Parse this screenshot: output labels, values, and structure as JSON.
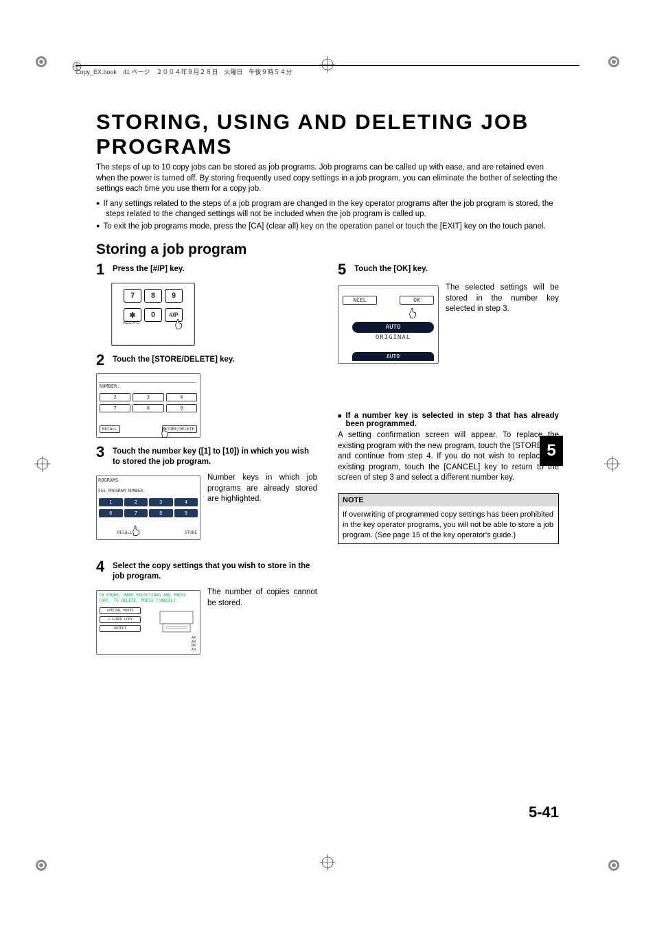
{
  "header": {
    "meta_line": "Copy_EX.book　41 ページ　２００４年９月２８日　火曜日　午後９時５４分"
  },
  "title": "STORING, USING AND DELETING JOB PROGRAMS",
  "intro": "The steps of up to 10 copy jobs can be stored as job programs. Job programs can be called up with ease, and are retained even when the power is turned off. By storing frequently used copy settings in  a job program, you can eliminate the bother of selecting the settings each time you use them for a copy job.",
  "bullets": [
    "If any settings related to the steps of a job program are changed in the key operator programs after the job program is stored, the steps related to the changed settings will not be included when the job program is called up.",
    "To exit the job programs mode, press the [CA] (clear all) key on the operation panel or touch the [EXIT] key on the touch panel."
  ],
  "section_title": "Storing a job program",
  "steps": {
    "s1": {
      "num": "1",
      "title": "Press the [#/P] key."
    },
    "s2": {
      "num": "2",
      "title": "Touch the [STORE/DELETE] key."
    },
    "s3": {
      "num": "3",
      "title": "Touch the number key ([1] to [10]) in which you wish to stored the job program.",
      "body": "Number keys in which job programs are already stored are highlighted."
    },
    "s4": {
      "num": "4",
      "title": "Select the copy settings that you wish to store in the job program.",
      "body": "The number of copies cannot be stored."
    },
    "s5": {
      "num": "5",
      "title": "Touch the [OK] key.",
      "body": "The selected settings will be stored in the number key selected in step 3."
    }
  },
  "fig_keypad": {
    "row1": [
      "7",
      "8",
      "9"
    ],
    "row2": [
      "✱",
      "0",
      "#/P"
    ],
    "label": "ACC.#-C"
  },
  "fig_store_delete": {
    "header": "NUMBER.",
    "row1": [
      "2",
      "3",
      "4"
    ],
    "row2": [
      "7",
      "8",
      "9"
    ],
    "left_btn": "RECALL",
    "right_btn": "STORE/DELETE"
  },
  "fig_program_number": {
    "header": "ROGRAMS",
    "sub": "ESS PROGRAM NUMBER.",
    "row1": [
      "1",
      "2",
      "3",
      "4"
    ],
    "row2": [
      "6",
      "7",
      "8",
      "9"
    ],
    "left_btn": "RECALL",
    "right_btn": "STORE"
  },
  "fig_settings": {
    "msg1": "TO STORE, MAKE SELECTIONS AND PRESS",
    "msg2": "[OK]. TO DELETE, PRESS [CANCEL].",
    "btns": [
      "SPECIAL MODES",
      "2-SIDED COPY",
      "OUTPUT"
    ],
    "sizes": [
      "A4",
      "A4",
      "B4",
      "A3"
    ]
  },
  "fig_ok": {
    "left_btn": "NCEL",
    "right_btn": "OK",
    "mid": "AUTO",
    "below": "ORIGINAL",
    "bottom": "AUTO"
  },
  "sub_heading": "If a number key is selected in step 3 that has already been programmed.",
  "sub_body": "A setting confirmation screen will appear. To replace the existing program with the new program, touch the [STORE] key and continue from step 4. If you do not wish to replace the existing program, touch the [CANCEL] key to return to the screen of step 3 and select a different number key.",
  "note": {
    "title": "NOTE",
    "body": "If overwriting of programmed copy settings has been prohibited in the key operator programs, you will not be able to store a job program. (See page 15 of the key operator's guide.)"
  },
  "chapter": "5",
  "page_number": "5-41"
}
